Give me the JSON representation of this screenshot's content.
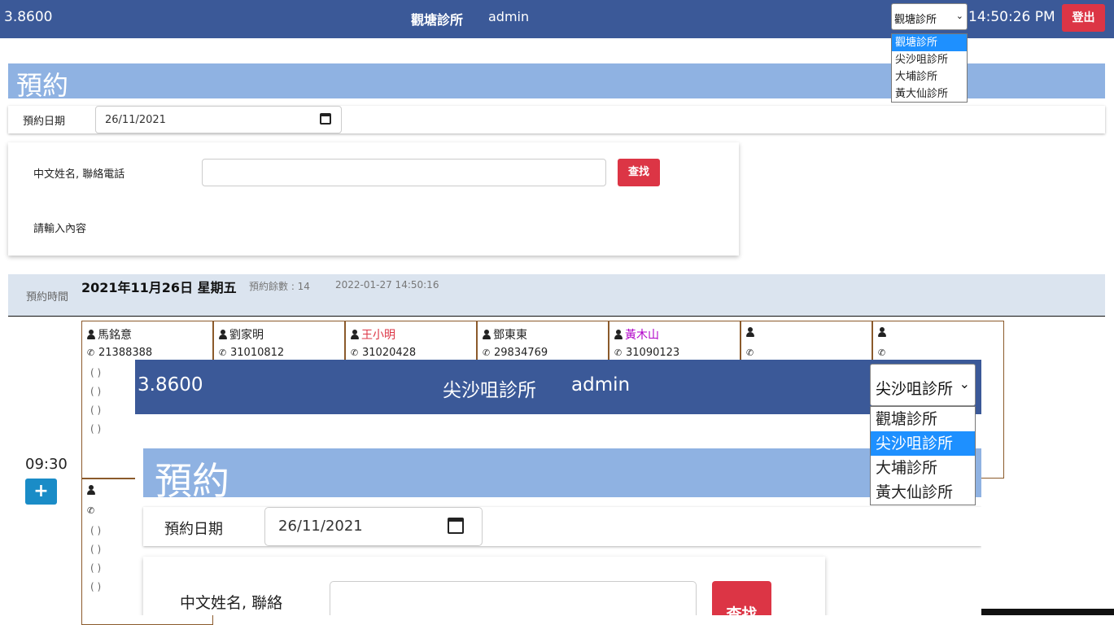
{
  "header": {
    "version": "3.8600",
    "clinic": "觀塘診所",
    "user": "admin",
    "selected_clinic": "觀塘診所",
    "time": "14:50:26 PM",
    "logout_label": "登出",
    "clinic_options": [
      "觀塘診所",
      "尖沙咀診所",
      "大埔診所",
      "黃大仙診所"
    ]
  },
  "reservation": {
    "title": "預約",
    "date_label": "預約日期",
    "date_value": "26/11/2021"
  },
  "search": {
    "label": "中文姓名, 聯絡電話",
    "value": "",
    "button_label": "查找",
    "hint": "請輸入內容"
  },
  "schedule": {
    "time_col_label": "預約時間",
    "date_heading": "2021年11月26日 星期五",
    "remaining": "預約餘數 : 14",
    "timestamp": "2022-01-27 14:50:16",
    "slot_time": "09:30",
    "slots": [
      {
        "name": "馬銘意",
        "phone": "21388388",
        "paren": [
          "( )",
          "( )",
          "( )",
          "( )"
        ],
        "color": "#222222"
      },
      {
        "name": "劉家明",
        "phone": "31010812",
        "paren": [],
        "color": "#222222"
      },
      {
        "name": "王小明",
        "phone": "31020428",
        "paren": [],
        "color": "#dc3545"
      },
      {
        "name": "鄧東東",
        "phone": "29834769",
        "paren": [],
        "color": "#222222"
      },
      {
        "name": "黃木山",
        "phone": "31090123",
        "paren": [],
        "color": "#b000c8"
      },
      {
        "name": "",
        "phone": "",
        "paren": [],
        "color": "#222222"
      },
      {
        "name": "",
        "phone": "",
        "paren": [],
        "color": "#222222"
      }
    ],
    "second_row_slot": {
      "name": "",
      "phone": "",
      "paren": [
        "( )",
        "( )",
        "( )",
        "( )"
      ]
    }
  },
  "overlay": {
    "version": "3.8600",
    "clinic": "尖沙咀診所",
    "user": "admin",
    "selected_clinic": "尖沙咀診所",
    "clinic_options": [
      "觀塘診所",
      "尖沙咀診所",
      "大埔診所",
      "黃大仙診所"
    ],
    "title": "預約",
    "date_label": "預約日期",
    "date_value": "26/11/2021",
    "search_label": "中文姓名, 聯絡",
    "search_button": "查找"
  }
}
